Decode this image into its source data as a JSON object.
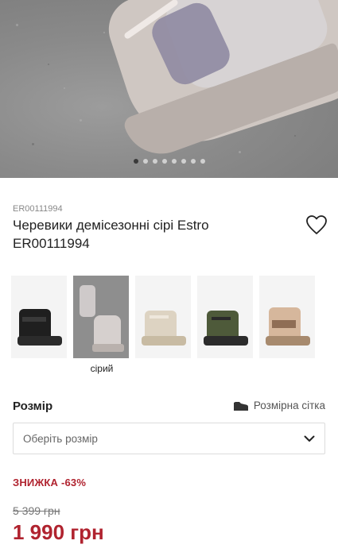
{
  "gallery": {
    "slide_count": 8,
    "active_slide": 1
  },
  "product": {
    "sku": "ER00111994",
    "title": "Черевики демісезонні сірі Estro ER00111994"
  },
  "variants": [
    {
      "color_name": "",
      "swatch": "#1f1f1f"
    },
    {
      "color_name": "сірий",
      "swatch": "#9a9a9a",
      "selected": true
    },
    {
      "color_name": "",
      "swatch": "#d9cfbd"
    },
    {
      "color_name": "",
      "swatch": "#4e5a3a"
    },
    {
      "color_name": "",
      "swatch": "#c9a88c"
    }
  ],
  "size": {
    "label": "Розмір",
    "chart_link": "Розмірна сітка",
    "placeholder": "Оберіть розмір"
  },
  "price": {
    "discount_label": "ЗНИЖКА -63%",
    "old": "5 399 грн",
    "current": "1 990 грн"
  },
  "colors": {
    "accent": "#b0232f"
  }
}
